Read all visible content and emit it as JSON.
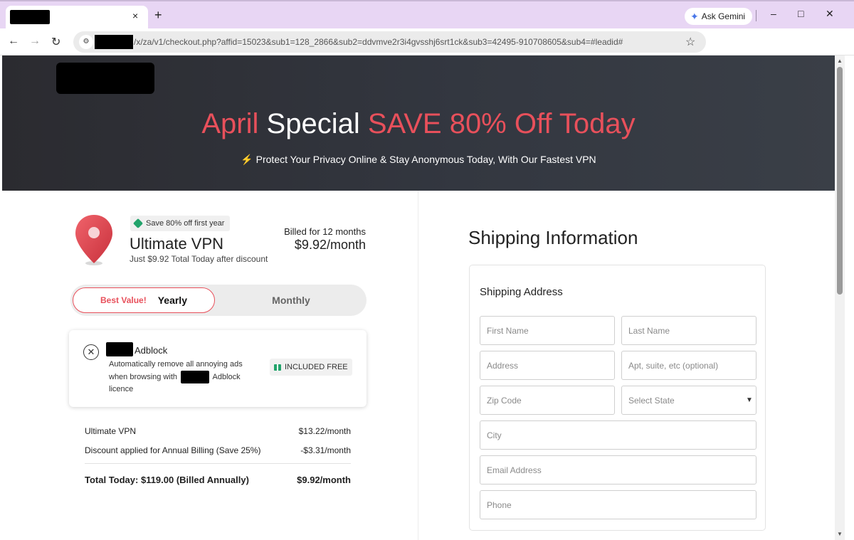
{
  "browser": {
    "new_tab_label": "+",
    "tab_close_label": "×",
    "gemini_label": "Ask Gemini",
    "url_text": "/x/za/v1/checkout.php?affid=15023&sub1=128_2866&sub2=ddvmve2r3i4gvsshj6srt1ck&sub3=42495-910708605&sub4=#leadid#",
    "win_min": "–",
    "win_max": "□",
    "win_close": "✕",
    "icons": [
      "back-icon",
      "forward-icon",
      "reload-icon",
      "site-info-icon",
      "bookmark-star-icon"
    ]
  },
  "hero": {
    "headline_part1": "April",
    "headline_part2": " Special ",
    "headline_part3": "SAVE 80% Off Today",
    "subline_bolt": "⚡",
    "subline": " Protect Your Privacy Online & Stay Anonymous Today, With Our Fastest VPN",
    "colors": {
      "accent_red": "#e8505b",
      "bolt_yellow": "#f5c518"
    }
  },
  "product": {
    "badge": "Save 80% off first year",
    "name": "Ultimate VPN",
    "subtitle": "Just $9.92 Total Today after discount",
    "billed_for": "Billed for 12 months",
    "price": "$9.92/month"
  },
  "plan_toggle": {
    "best_value": "Best Value!",
    "yearly": "Yearly",
    "monthly": "Monthly",
    "selected": "Yearly"
  },
  "addon": {
    "title": "Adblock",
    "desc_line1": "Automatically remove all annoying ads",
    "desc_line2_pre": "when browsing with",
    "desc_line2_post": "Adblock",
    "desc_line3": "licence",
    "included": "INCLUDED FREE"
  },
  "summary": {
    "rows": [
      {
        "label": "Ultimate VPN",
        "value": "$13.22/month"
      },
      {
        "label": "Discount applied for Annual Billing (Save 25%)",
        "value": "-$3.31/month"
      }
    ],
    "total_label": "Total Today: $119.00 (Billed Annually)",
    "total_value": "$9.92/month"
  },
  "shipping": {
    "heading": "Shipping Information",
    "card_title": "Shipping Address",
    "placeholders": {
      "first_name": "First Name",
      "last_name": "Last Name",
      "address": "Address",
      "apt": "Apt, suite, etc (optional)",
      "zip": "Zip Code",
      "state": "Select State",
      "city": "City",
      "email": "Email Address",
      "phone": "Phone"
    }
  }
}
